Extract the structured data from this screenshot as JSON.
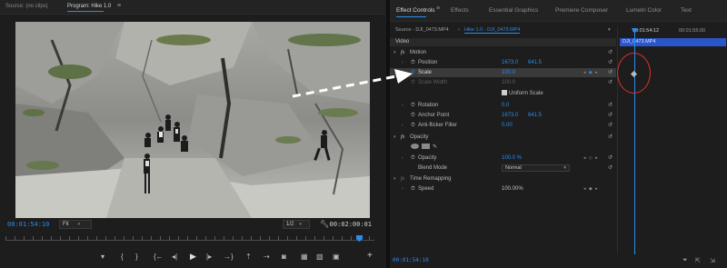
{
  "monitor": {
    "tabs": {
      "source": "Source: (no clips)",
      "program": "Program: Hike 1.0",
      "menu_icon": "≡"
    },
    "current_timecode": "00:01:54:10",
    "duration_timecode": "00:02:00:01",
    "zoom_select": "Fit",
    "resolution_select": "1/2",
    "settings_icon": "wrench-icon",
    "controls": {
      "marker": "▾",
      "in": "{",
      "out": "}",
      "goto_in": "{←",
      "step_back": "◂|",
      "play": "▶",
      "step_fwd": "|▸",
      "goto_out": "→}",
      "lift": "⇡",
      "extract": "⇢",
      "export_frame": "◙",
      "btn_a": "▦",
      "btn_b": "▧",
      "add": "+"
    }
  },
  "effect_controls": {
    "tabs": [
      "Effect Controls",
      "Effects",
      "Essential Graphics",
      "Premiere Composer",
      "Lumetri Color",
      "Text"
    ],
    "menu_icon": "≡",
    "source_label": "Source - DJI_0473.MP4",
    "arrow": "›",
    "sequence_label": "Hike 1.0 - DJI_0473.MP4",
    "section": "Video",
    "motion": {
      "fx": "fx",
      "label": "Motion",
      "position": {
        "name": "Position",
        "x": "1673.0",
        "y": "641.5"
      },
      "scale": {
        "name": "Scale",
        "value": "100.0"
      },
      "scale_width": {
        "name": "Scale Width",
        "value": "100.0"
      },
      "uniform_scale": "Uniform Scale",
      "rotation": {
        "name": "Rotation",
        "value": "0.0"
      },
      "anchor_point": {
        "name": "Anchor Point",
        "x": "1673.0",
        "y": "641.5"
      },
      "anti_flicker": {
        "name": "Anti-flicker Filter",
        "value": "0.00"
      }
    },
    "opacity": {
      "fx": "fx",
      "label": "Opacity",
      "opacity": {
        "name": "Opacity",
        "value": "100.0 %"
      },
      "blend_mode": {
        "name": "Blend Mode",
        "value": "Normal"
      }
    },
    "time_remap": {
      "fx": "fx",
      "label": "Time Remapping",
      "speed": {
        "name": "Speed",
        "value": "100.00%"
      }
    },
    "footer_timecode": "00:01:54:10",
    "timeline": {
      "tc1": "00:01:54:12",
      "tc2": "00:01:55:00",
      "clip": "DJI_0473.MP4"
    }
  },
  "colors": {
    "accent": "#2d8ceb",
    "highlight_circle": "#e0312b",
    "panel_bg": "#1d1d1d"
  }
}
